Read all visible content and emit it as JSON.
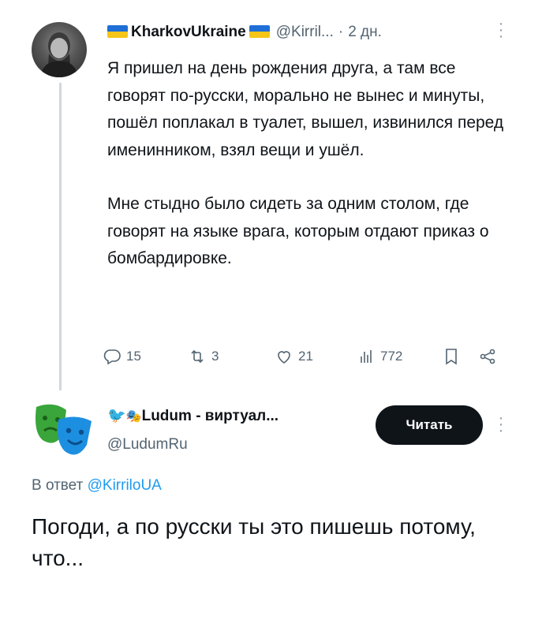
{
  "tweet": {
    "author": {
      "name": "KharkovUkraine",
      "handle": "@Kirril...",
      "time": "2 дн."
    },
    "paragraphs": [
      "Я пришел на день рождения друга, а там все говорят по-русски, морально не вынес и минуты, пошёл поплакал в туалет, вышел, извинился перед именинником, взял вещи и ушёл.",
      "Мне стыдно было сидеть за одним столом, где говорят на языке врага, которым отдают приказ о бомбардировке."
    ],
    "stats": {
      "replies": "15",
      "retweets": "3",
      "likes": "21",
      "views": "772"
    }
  },
  "reply": {
    "author": {
      "name": "Ludum - виртуал...",
      "handle": "@LudumRu"
    },
    "follow_label": "Читать",
    "reply_prefix": "В ответ",
    "reply_mention": "@KirriloUA",
    "text": "Погоди, а по русски ты это пишешь потому, что..."
  },
  "colors": {
    "accent": "#1d9bf0",
    "muted": "#536471",
    "ua_blue": "#1f6fd6",
    "ua_yellow": "#f5c518"
  }
}
